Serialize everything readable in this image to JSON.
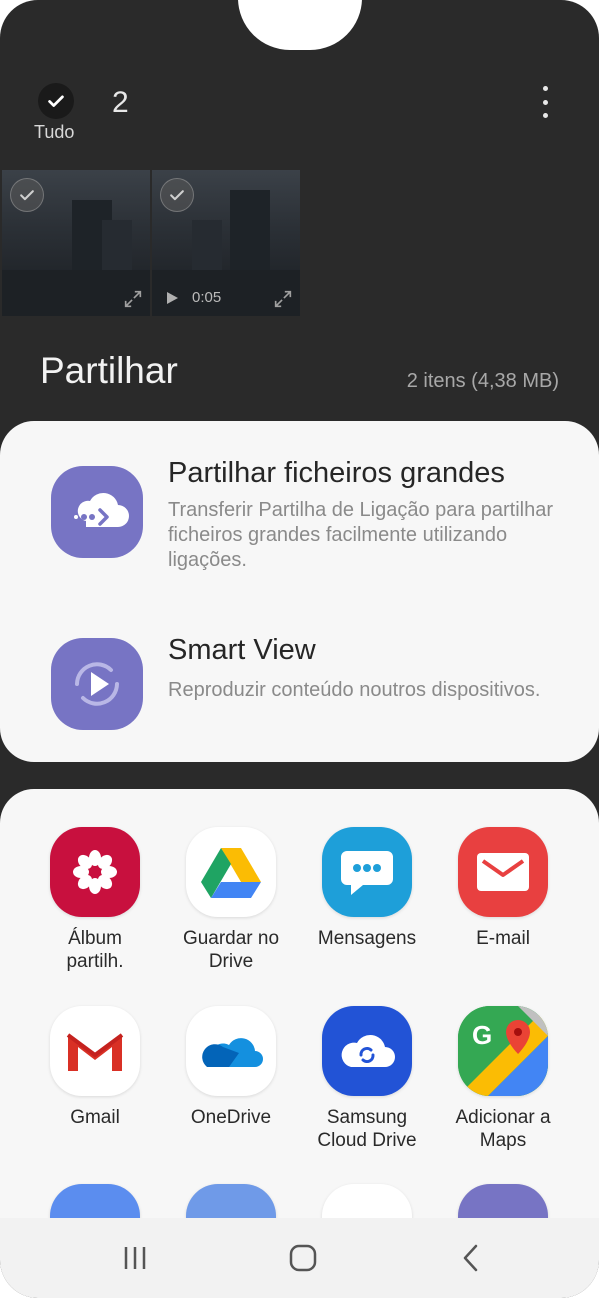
{
  "header": {
    "select_all_label": "Tudo",
    "selected_count": "2"
  },
  "thumbnails": [
    {
      "kind": "image"
    },
    {
      "kind": "video",
      "duration": "0:05"
    }
  ],
  "share": {
    "title": "Partilhar",
    "summary": "2 itens (4,38 MB)"
  },
  "options": [
    {
      "title": "Partilhar ficheiros grandes",
      "description": "Transferir Partilha de Ligação para partilhar ficheiros grandes facilmente utilizando ligações.",
      "icon": "cloud-link-icon"
    },
    {
      "title": "Smart View",
      "description": "Reproduzir conteúdo noutros dispositivos.",
      "icon": "smart-view-icon"
    }
  ],
  "apps": [
    {
      "line1": "Álbum",
      "line2": "partilh.",
      "icon": "flower-icon",
      "color": "#c8103e"
    },
    {
      "line1": "Guardar no",
      "line2": "Drive",
      "icon": "google-drive-icon",
      "color": "#ffffff"
    },
    {
      "line1": "Mensagens",
      "line2": "",
      "icon": "messages-icon",
      "color": "#1e9fd9"
    },
    {
      "line1": "E-mail",
      "line2": "",
      "icon": "email-icon",
      "color": "#e84040"
    },
    {
      "line1": "Gmail",
      "line2": "",
      "icon": "gmail-icon",
      "color": "#ffffff"
    },
    {
      "line1": "OneDrive",
      "line2": "",
      "icon": "onedrive-icon",
      "color": "#ffffff"
    },
    {
      "line1": "Samsung",
      "line2": "Cloud Drive",
      "icon": "samsung-cloud-icon",
      "color": "#2253d6"
    },
    {
      "line1": "Adicionar a",
      "line2": "Maps",
      "icon": "google-maps-icon",
      "color": "#34a853"
    }
  ],
  "navbar": {
    "recents": "recents-icon",
    "home": "home-icon",
    "back": "back-icon"
  }
}
